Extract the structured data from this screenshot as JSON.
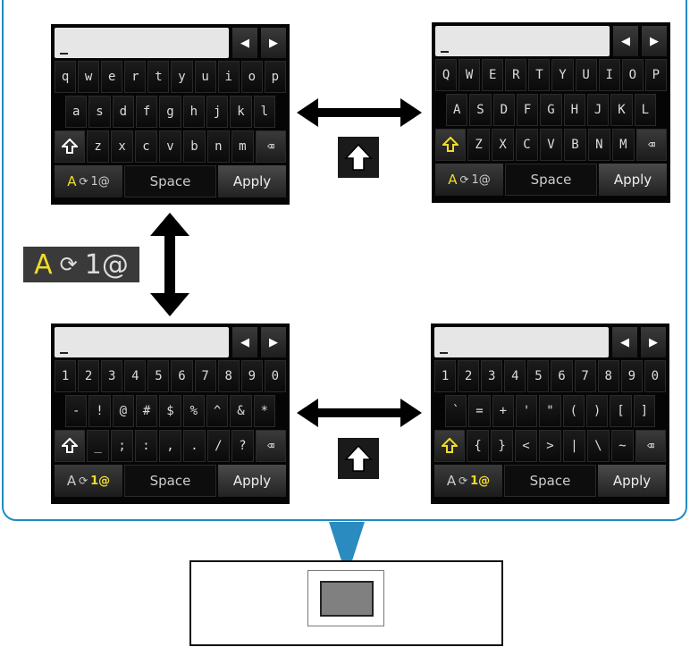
{
  "colors": {
    "accent_blue": "#1f8ac4",
    "active_yellow": "#f1dc2a"
  },
  "keyboards": [
    {
      "id": "lowercase",
      "cursor": "_",
      "nav": [
        "◀",
        "▶"
      ],
      "rows": [
        [
          "q",
          "w",
          "e",
          "r",
          "t",
          "y",
          "u",
          "i",
          "o",
          "p"
        ],
        [
          "a",
          "s",
          "d",
          "f",
          "g",
          "h",
          "j",
          "k",
          "l"
        ],
        [
          "z",
          "x",
          "c",
          "v",
          "b",
          "n",
          "m"
        ]
      ],
      "shift_active": false,
      "mode": {
        "a": "A",
        "b": "1@",
        "active": "a"
      },
      "space": "Space",
      "apply": "Apply"
    },
    {
      "id": "uppercase",
      "cursor": "_",
      "nav": [
        "◀",
        "▶"
      ],
      "rows": [
        [
          "Q",
          "W",
          "E",
          "R",
          "T",
          "Y",
          "U",
          "I",
          "O",
          "P"
        ],
        [
          "A",
          "S",
          "D",
          "F",
          "G",
          "H",
          "J",
          "K",
          "L"
        ],
        [
          "Z",
          "X",
          "C",
          "V",
          "B",
          "N",
          "M"
        ]
      ],
      "shift_active": true,
      "mode": {
        "a": "A",
        "b": "1@",
        "active": "a"
      },
      "space": "Space",
      "apply": "Apply"
    },
    {
      "id": "numbers",
      "cursor": "_",
      "nav": [
        "◀",
        "▶"
      ],
      "rows": [
        [
          "1",
          "2",
          "3",
          "4",
          "5",
          "6",
          "7",
          "8",
          "9",
          "0"
        ],
        [
          "-",
          "!",
          "@",
          "#",
          "$",
          "%",
          "^",
          "&",
          "*"
        ],
        [
          "_",
          ";",
          ":",
          ",",
          ".",
          "/",
          "?"
        ]
      ],
      "shift_active": false,
      "mode": {
        "a": "A",
        "b": "1@",
        "active": "b"
      },
      "space": "Space",
      "apply": "Apply"
    },
    {
      "id": "symbols",
      "cursor": "_",
      "nav": [
        "◀",
        "▶"
      ],
      "rows": [
        [
          "1",
          "2",
          "3",
          "4",
          "5",
          "6",
          "7",
          "8",
          "9",
          "0"
        ],
        [
          "`",
          "=",
          "+",
          "'",
          "\"",
          "(",
          ")",
          "[",
          "]"
        ],
        [
          "{",
          "}",
          "<",
          ">",
          "|",
          "\\",
          "~"
        ]
      ],
      "shift_active": true,
      "mode": {
        "a": "A",
        "b": "1@",
        "active": "b"
      },
      "space": "Space",
      "apply": "Apply"
    }
  ],
  "mode_legend": {
    "a": "A",
    "b": "1@"
  },
  "icons": {
    "shift": "shift-arrow-icon",
    "delete": "backspace-icon",
    "toggle": "cycle-arrows-icon",
    "switch": "double-arrow-icon"
  }
}
